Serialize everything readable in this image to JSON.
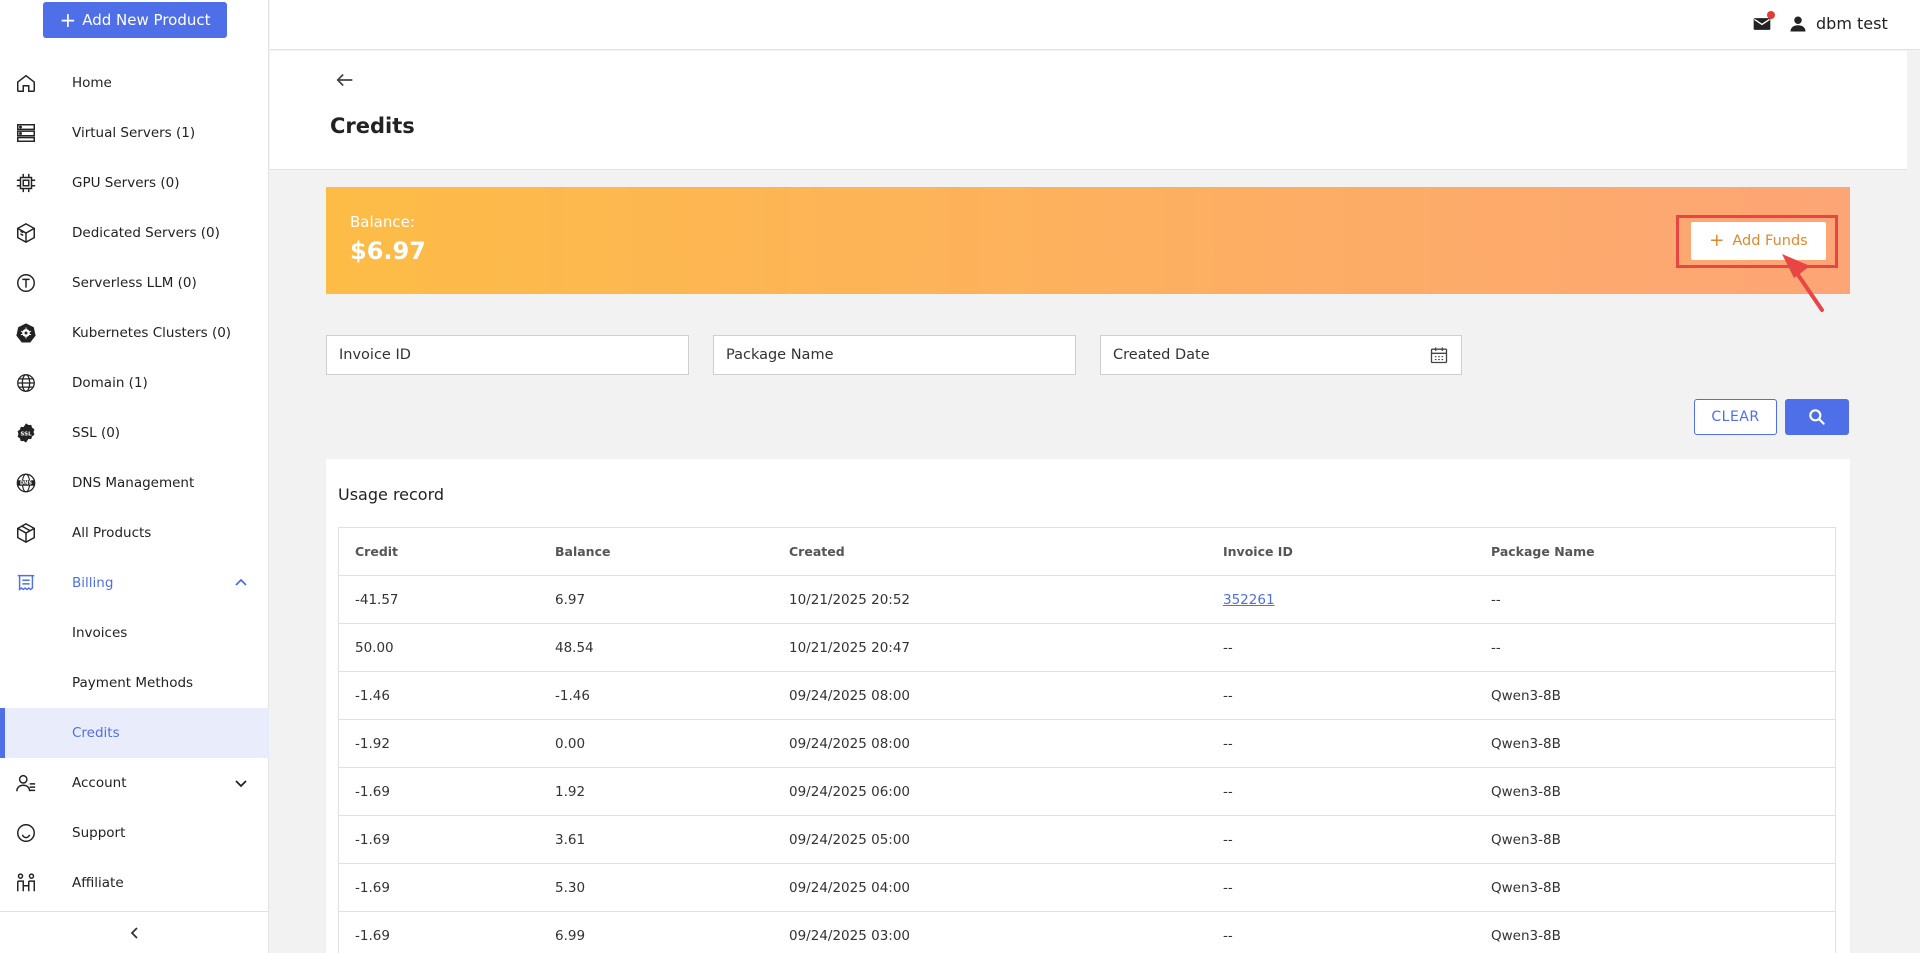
{
  "sidebar": {
    "add_product_label": "Add New Product",
    "items": [
      {
        "label": "Home",
        "icon": "home-icon"
      },
      {
        "label": "Virtual Servers (1)",
        "icon": "server-icon"
      },
      {
        "label": "GPU Servers (0)",
        "icon": "cpu-icon"
      },
      {
        "label": "Dedicated Servers (0)",
        "icon": "dedicated-server-icon"
      },
      {
        "label": "Serverless LLM (0)",
        "icon": "llm-icon"
      },
      {
        "label": "Kubernetes Clusters (0)",
        "icon": "kubernetes-icon"
      },
      {
        "label": "Domain (1)",
        "icon": "globe-icon"
      },
      {
        "label": "SSL (0)",
        "icon": "ssl-icon"
      },
      {
        "label": "DNS Management",
        "icon": "dns-icon"
      },
      {
        "label": "All Products",
        "icon": "box-icon"
      }
    ],
    "billing": {
      "label": "Billing",
      "icon": "billing-icon",
      "subitems": [
        "Invoices",
        "Payment Methods",
        "Credits"
      ],
      "active": "Credits"
    },
    "bottom_items": [
      {
        "label": "Account",
        "icon": "account-icon"
      },
      {
        "label": "Support",
        "icon": "support-icon"
      },
      {
        "label": "Affiliate",
        "icon": "affiliate-icon"
      }
    ]
  },
  "topbar": {
    "username": "dbm test"
  },
  "page": {
    "title": "Credits",
    "balance_label": "Balance:",
    "balance_value": "$6.97",
    "add_funds_label": "Add Funds"
  },
  "filters": {
    "invoice_id": "Invoice ID",
    "package_name": "Package Name",
    "created_date": "Created Date",
    "clear_label": "CLEAR"
  },
  "usage": {
    "title": "Usage record",
    "columns": [
      "Credit",
      "Balance",
      "Created",
      "Invoice ID",
      "Package Name"
    ],
    "rows": [
      [
        "-41.57",
        "6.97",
        "10/21/2025 20:52",
        "352261",
        "--"
      ],
      [
        "50.00",
        "48.54",
        "10/21/2025 20:47",
        "--",
        "--"
      ],
      [
        "-1.46",
        "-1.46",
        "09/24/2025 08:00",
        "--",
        "Qwen3-8B"
      ],
      [
        "-1.92",
        "0.00",
        "09/24/2025 08:00",
        "--",
        "Qwen3-8B"
      ],
      [
        "-1.69",
        "1.92",
        "09/24/2025 06:00",
        "--",
        "Qwen3-8B"
      ],
      [
        "-1.69",
        "3.61",
        "09/24/2025 05:00",
        "--",
        "Qwen3-8B"
      ],
      [
        "-1.69",
        "5.30",
        "09/24/2025 04:00",
        "--",
        "Qwen3-8B"
      ],
      [
        "-1.69",
        "6.99",
        "09/24/2025 03:00",
        "--",
        "Qwen3-8B"
      ]
    ]
  },
  "colors": {
    "accent": "#4f6fe8",
    "banner_start": "#fdbc46",
    "banner_end": "#fda576",
    "highlight": "#e84545"
  }
}
